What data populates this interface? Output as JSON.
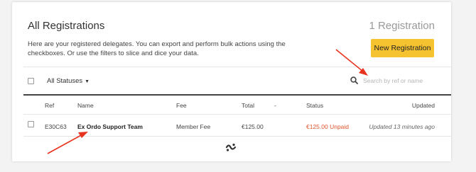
{
  "header": {
    "title": "All Registrations",
    "count": "1 Registration",
    "description": "Here are your registered delegates. You can export and perform bulk actions using the checkboxes. Or use the filters to slice and dice your data.",
    "new_button": "New Registration"
  },
  "filters": {
    "status": "All Statuses",
    "search_placeholder": "Search by ref or name"
  },
  "table": {
    "columns": [
      "Ref",
      "Name",
      "Fee",
      "Total",
      "-",
      "Status",
      "Updated"
    ],
    "rows": [
      {
        "ref": "E30C63",
        "name": "Ex Ordo Support Team",
        "fee": "Member Fee",
        "total": "€125.00",
        "status": "€125.00 Unpaid",
        "updated": "Updated 13 minutes ago"
      }
    ]
  },
  "colors": {
    "accent_button": "#f5c230",
    "unpaid": "#e0532c",
    "annotation_arrow": "#e8331f"
  },
  "icons": [
    "search-icon",
    "chevron-down-icon",
    "loading-spinner-icon"
  ]
}
